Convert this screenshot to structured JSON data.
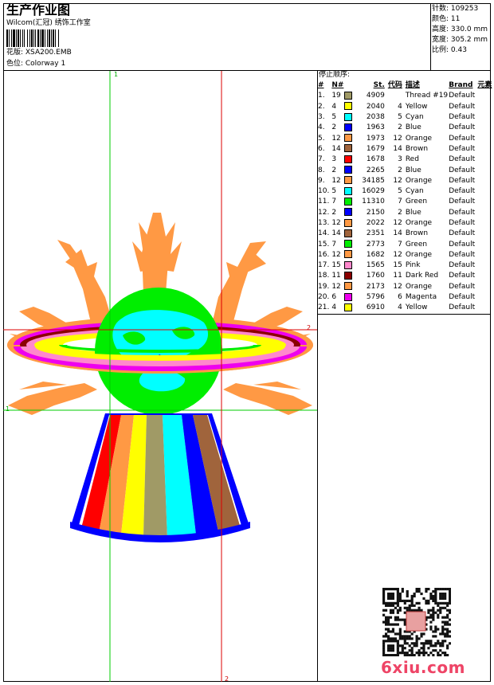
{
  "header": {
    "title": "生产作业图",
    "company": "Wilcom(汇冠) 绣饰工作室",
    "design": "花版: XSA200.EMB",
    "colorway": "色位: Colorway 1"
  },
  "stats": {
    "stitches": "针数: 109253",
    "colors": "颜色: 11",
    "height": "高度: 330.0 mm",
    "width": "宽度: 305.2 mm",
    "scale": "比例: 0.43"
  },
  "sequence": {
    "title": "停止顺序:",
    "headers": [
      "#",
      "N#",
      "St.",
      "代码",
      "描述",
      "Brand",
      "元素"
    ],
    "rows": [
      {
        "idx": "1.",
        "n": "19",
        "color": "#a09a66",
        "st": "4909",
        "code": "",
        "desc": "Thread #19",
        "brand": "Default"
      },
      {
        "idx": "2.",
        "n": "4",
        "color": "#ffff00",
        "st": "2040",
        "code": "4",
        "desc": "Yellow",
        "brand": "Default"
      },
      {
        "idx": "3.",
        "n": "5",
        "color": "#00ffff",
        "st": "2038",
        "code": "5",
        "desc": "Cyan",
        "brand": "Default"
      },
      {
        "idx": "4.",
        "n": "2",
        "color": "#0000ff",
        "st": "1963",
        "code": "2",
        "desc": "Blue",
        "brand": "Default"
      },
      {
        "idx": "5.",
        "n": "12",
        "color": "#ff9944",
        "st": "1973",
        "code": "12",
        "desc": "Orange",
        "brand": "Default"
      },
      {
        "idx": "6.",
        "n": "14",
        "color": "#a0643c",
        "st": "1679",
        "code": "14",
        "desc": "Brown",
        "brand": "Default"
      },
      {
        "idx": "7.",
        "n": "3",
        "color": "#ff0000",
        "st": "1678",
        "code": "3",
        "desc": "Red",
        "brand": "Default"
      },
      {
        "idx": "8.",
        "n": "2",
        "color": "#0000ff",
        "st": "2265",
        "code": "2",
        "desc": "Blue",
        "brand": "Default"
      },
      {
        "idx": "9.",
        "n": "12",
        "color": "#ff9944",
        "st": "34185",
        "code": "12",
        "desc": "Orange",
        "brand": "Default"
      },
      {
        "idx": "10.",
        "n": "5",
        "color": "#00ffff",
        "st": "16029",
        "code": "5",
        "desc": "Cyan",
        "brand": "Default"
      },
      {
        "idx": "11.",
        "n": "7",
        "color": "#00ee00",
        "st": "11310",
        "code": "7",
        "desc": "Green",
        "brand": "Default"
      },
      {
        "idx": "12.",
        "n": "2",
        "color": "#0000ff",
        "st": "2150",
        "code": "2",
        "desc": "Blue",
        "brand": "Default"
      },
      {
        "idx": "13.",
        "n": "12",
        "color": "#ff9944",
        "st": "2022",
        "code": "12",
        "desc": "Orange",
        "brand": "Default"
      },
      {
        "idx": "14.",
        "n": "14",
        "color": "#a0643c",
        "st": "2351",
        "code": "14",
        "desc": "Brown",
        "brand": "Default"
      },
      {
        "idx": "15.",
        "n": "7",
        "color": "#00ee00",
        "st": "2773",
        "code": "7",
        "desc": "Green",
        "brand": "Default"
      },
      {
        "idx": "16.",
        "n": "12",
        "color": "#ff9944",
        "st": "1682",
        "code": "12",
        "desc": "Orange",
        "brand": "Default"
      },
      {
        "idx": "17.",
        "n": "15",
        "color": "#ff88cc",
        "st": "1565",
        "code": "15",
        "desc": "Pink",
        "brand": "Default"
      },
      {
        "idx": "18.",
        "n": "11",
        "color": "#8b0000",
        "st": "1760",
        "code": "11",
        "desc": "Dark Red",
        "brand": "Default"
      },
      {
        "idx": "19.",
        "n": "12",
        "color": "#ff9944",
        "st": "2173",
        "code": "12",
        "desc": "Orange",
        "brand": "Default"
      },
      {
        "idx": "20.",
        "n": "6",
        "color": "#ee00ee",
        "st": "5796",
        "code": "6",
        "desc": "Magenta",
        "brand": "Default"
      },
      {
        "idx": "21.",
        "n": "4",
        "color": "#ffff00",
        "st": "6910",
        "code": "4",
        "desc": "Yellow",
        "brand": "Default"
      }
    ]
  },
  "guides": {
    "green_top": "1",
    "green_left": "1",
    "red_right": "2",
    "red_bottom": "2",
    "green_color": "#00cc00",
    "red_color": "#dd0000"
  },
  "watermark": "6xiu.com"
}
